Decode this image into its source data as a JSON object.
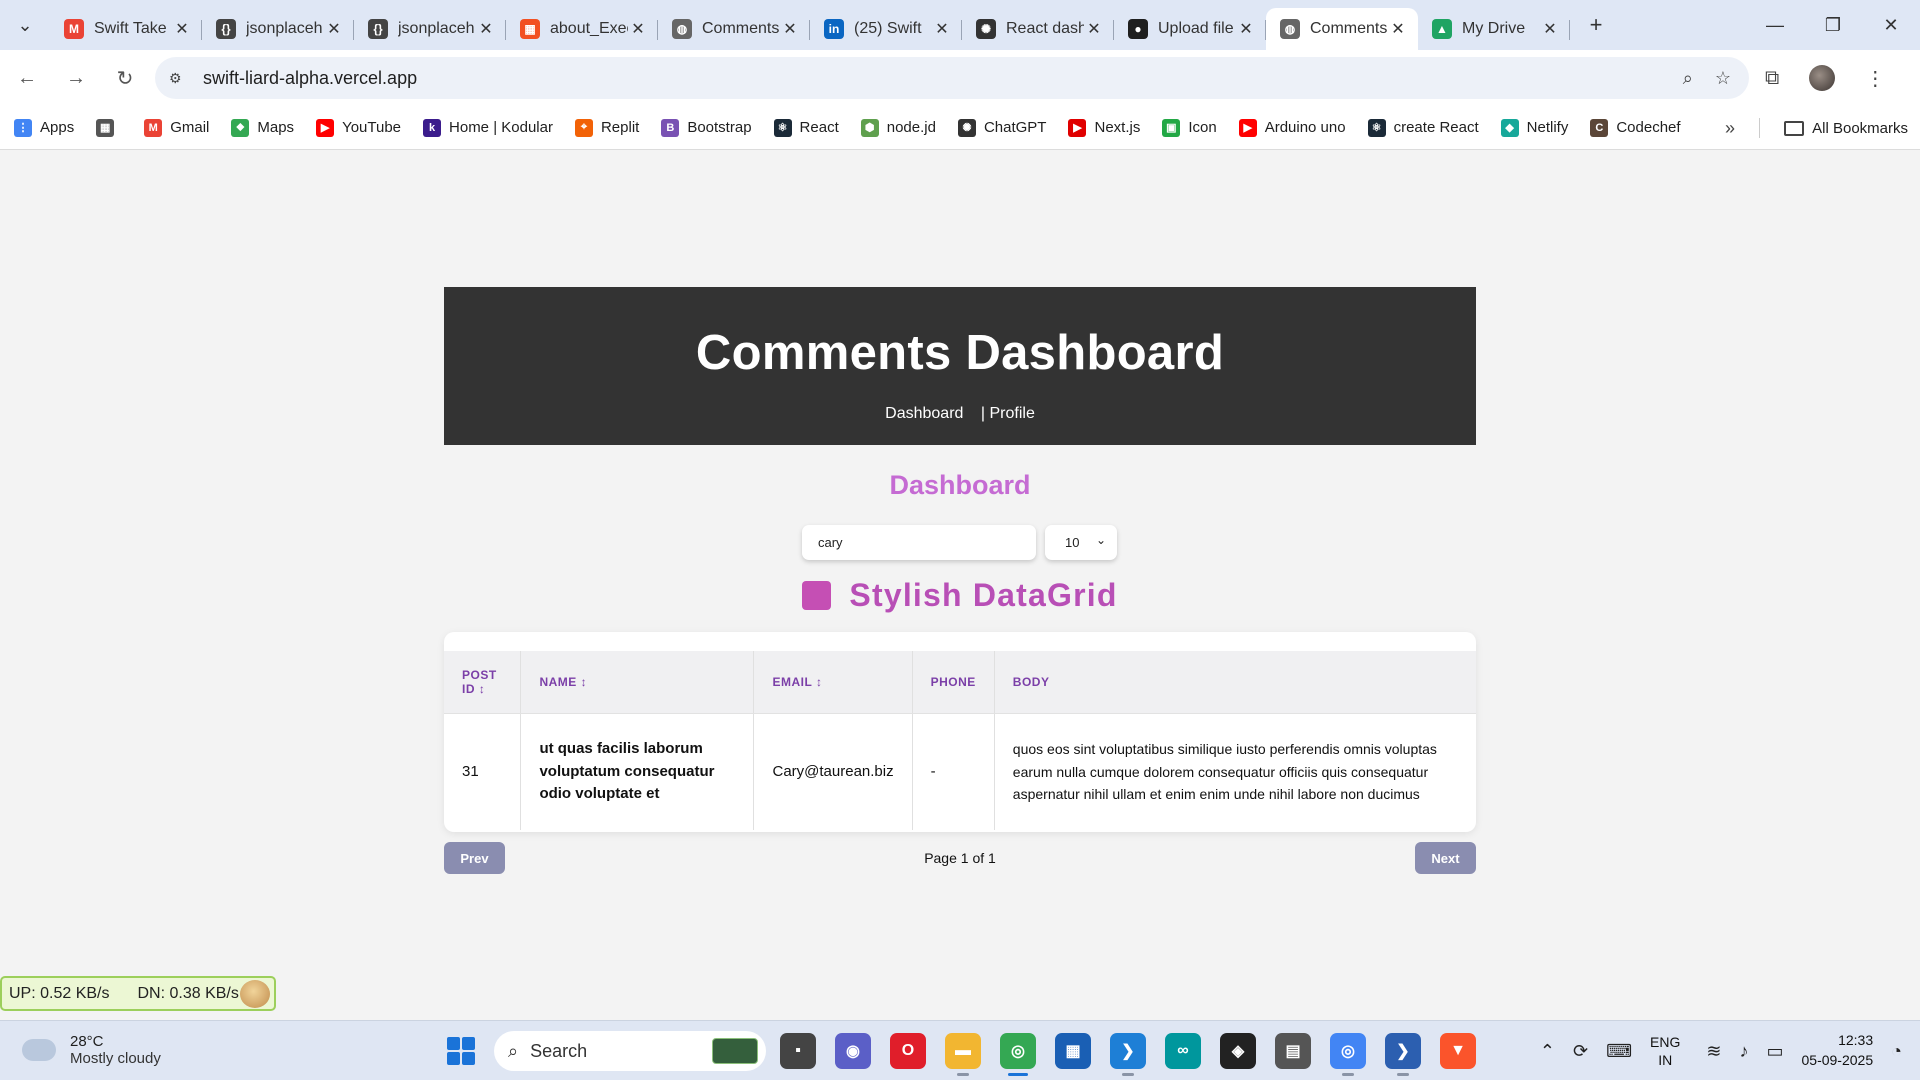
{
  "browser": {
    "tabs": [
      {
        "title": "Swift Take",
        "favicon": "gmail-icon",
        "color": "#ea4335",
        "glyph": "M"
      },
      {
        "title": "jsonplaceh",
        "favicon": "jsonplaceholder-icon",
        "color": "#444444",
        "glyph": "{}"
      },
      {
        "title": "jsonplaceh",
        "favicon": "jsonplaceholder-icon",
        "color": "#444444",
        "glyph": "{}"
      },
      {
        "title": "about_Exec",
        "favicon": "microsoft-icon",
        "color": "#f25022",
        "glyph": "▦"
      },
      {
        "title": "Comments",
        "favicon": "globe-icon",
        "color": "#666666",
        "glyph": "◍"
      },
      {
        "title": "(25) Swift",
        "favicon": "linkedin-icon",
        "color": "#0a66c2",
        "glyph": "in"
      },
      {
        "title": "React dash",
        "favicon": "openai-icon",
        "color": "#333333",
        "glyph": "✺"
      },
      {
        "title": "Upload file",
        "favicon": "github-icon",
        "color": "#1f1f1f",
        "glyph": "●"
      },
      {
        "title": "Comments",
        "favicon": "globe-icon",
        "color": "#666666",
        "glyph": "◍",
        "active": true
      },
      {
        "title": "My Drive",
        "favicon": "google-drive-icon",
        "color": "#1fa463",
        "glyph": "▲"
      }
    ],
    "url": "swift-liard-alpha.vercel.app",
    "bookmarks": [
      {
        "label": "Apps",
        "icon": "apps-grid-icon",
        "color": "#4285f4",
        "glyph": "⋮"
      },
      {
        "label": "",
        "icon": "tab-groups-icon",
        "color": "#555555",
        "glyph": "▦"
      },
      {
        "label": "Gmail",
        "icon": "gmail-icon",
        "color": "#ea4335",
        "glyph": "M"
      },
      {
        "label": "Maps",
        "icon": "maps-icon",
        "color": "#34a853",
        "glyph": "⬥"
      },
      {
        "label": "YouTube",
        "icon": "youtube-icon",
        "color": "#ff0000",
        "glyph": "▶"
      },
      {
        "label": "Home | Kodular",
        "icon": "kodular-icon",
        "color": "#3b1c8c",
        "glyph": "k"
      },
      {
        "label": "Replit",
        "icon": "replit-icon",
        "color": "#f26207",
        "glyph": "⌖"
      },
      {
        "label": "Bootstrap",
        "icon": "bootstrap-icon",
        "color": "#7952b3",
        "glyph": "B"
      },
      {
        "label": "React",
        "icon": "react-icon",
        "color": "#1b2a38",
        "glyph": "⚛"
      },
      {
        "label": "node.jd",
        "icon": "nodejs-icon",
        "color": "#5fa04e",
        "glyph": "⬢"
      },
      {
        "label": "ChatGPT",
        "icon": "openai-icon",
        "color": "#333333",
        "glyph": "✺"
      },
      {
        "label": "Next.js",
        "icon": "nextjs-icon",
        "color": "#e00000",
        "glyph": "▶"
      },
      {
        "label": "Icon",
        "icon": "icon-site-icon",
        "color": "#22a845",
        "glyph": "▣"
      },
      {
        "label": "Arduino uno",
        "icon": "youtube-icon",
        "color": "#ff0000",
        "glyph": "▶"
      },
      {
        "label": "create React",
        "icon": "react-icon",
        "color": "#1b2a38",
        "glyph": "⚛"
      },
      {
        "label": "Netlify",
        "icon": "netlify-icon",
        "color": "#17a89a",
        "glyph": "◆"
      },
      {
        "label": "Codechef",
        "icon": "codechef-icon",
        "color": "#5b4638",
        "glyph": "C"
      }
    ],
    "all_bookmarks": "All Bookmarks"
  },
  "page": {
    "header_title": "Comments Dashboard",
    "nav_dashboard": "Dashboard",
    "nav_profile": "| Profile",
    "section_title": "Dashboard",
    "search_value": "cary",
    "page_size": "10",
    "grid_title": "Stylish DataGrid",
    "accent_color": "#c56bd3",
    "columns": {
      "post_id": "POST ID",
      "name": "NAME",
      "email": "EMAIL",
      "phone": "PHONE",
      "body": "BODY",
      "sort_glyph": "↕"
    },
    "rows": [
      {
        "post_id": "31",
        "name": "ut quas facilis laborum voluptatum consequatur odio voluptate et",
        "email": "Cary@taurean.biz",
        "phone": "-",
        "body": "quos eos sint voluptatibus similique iusto perferendis omnis voluptas earum nulla cumque dolorem consequatur officiis quis consequatur aspernatur nihil ullam et enim enim unde nihil labore non ducimus"
      }
    ],
    "prev_label": "Prev",
    "next_label": "Next",
    "page_info": "Page 1 of 1"
  },
  "netspeed": {
    "up": "UP: 0.52 KB/s",
    "down": "DN: 0.38 KB/s"
  },
  "taskbar": {
    "weather_temp": "28°C",
    "weather_desc": "Mostly cloudy",
    "search_label": "Search",
    "lang_line1": "ENG",
    "lang_line2": "IN",
    "time": "12:33",
    "date": "05-09-2025",
    "apps": [
      {
        "name": "file-explorer-dark-icon",
        "color": "#444444",
        "glyph": "▪"
      },
      {
        "name": "meet-icon",
        "color": "#5b5fc7",
        "glyph": "◉"
      },
      {
        "name": "opera-icon",
        "color": "#e01e2a",
        "glyph": "O"
      },
      {
        "name": "file-explorer-icon",
        "color": "#f2b631",
        "glyph": "▬"
      },
      {
        "name": "chrome-icon",
        "color": "#34a853",
        "glyph": "◎"
      },
      {
        "name": "store-icon",
        "color": "#1a5fb4",
        "glyph": "▦"
      },
      {
        "name": "vscode-icon",
        "color": "#1e7fd6",
        "glyph": "❯"
      },
      {
        "name": "arduino-icon",
        "color": "#00979d",
        "glyph": "∞"
      },
      {
        "name": "figma-icon",
        "color": "#222222",
        "glyph": "◈"
      },
      {
        "name": "app-icon",
        "color": "#555555",
        "glyph": "▤"
      },
      {
        "name": "chrome-profile-icon",
        "color": "#4285f4",
        "glyph": "◎"
      },
      {
        "name": "powershell-icon",
        "color": "#2c5fb0",
        "glyph": "❯"
      },
      {
        "name": "brave-icon",
        "color": "#fb542b",
        "glyph": "▼"
      }
    ]
  }
}
